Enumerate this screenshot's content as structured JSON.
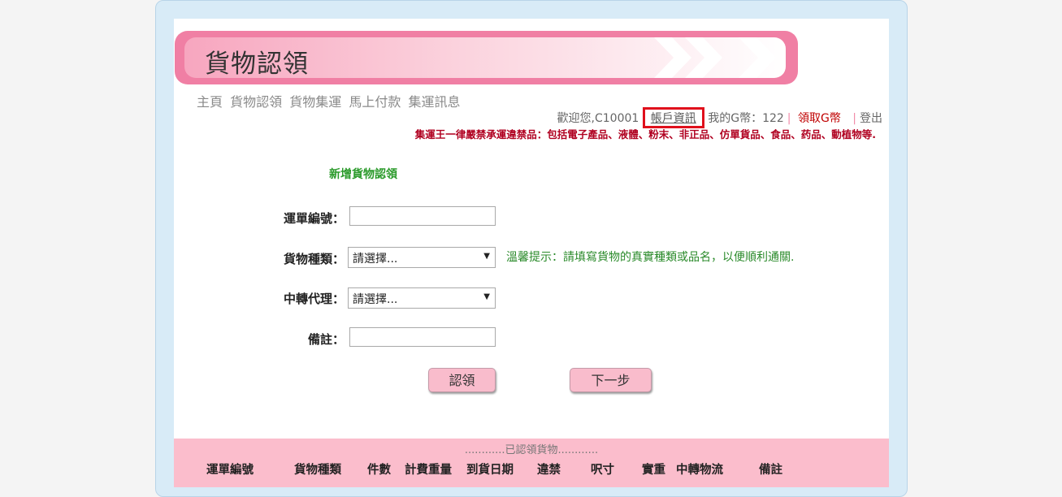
{
  "banner": {
    "title": "貨物認領"
  },
  "nav": {
    "items": [
      "主頁",
      "貨物認領",
      "貨物集運",
      "馬上付款",
      "集運訊息"
    ]
  },
  "userbar": {
    "welcome": "歡迎您,C10001",
    "account_link": "帳戶資訊",
    "gcoin_label": "我的G幣：122",
    "claim_gcoin": "領取G幣",
    "logout": "登出"
  },
  "notice": "集運王一律嚴禁承運違禁品：包括電子產品、液體、粉末、非正品、仿單貨品、食品、药品、動植物等.",
  "form": {
    "title": "新增貨物認領",
    "waybill_label": "運單編號：",
    "waybill_value": "",
    "type_label": "貨物種類：",
    "type_selected": "請選擇...",
    "agent_label": "中轉代理：",
    "agent_selected": "請選擇...",
    "remark_label": "備註：",
    "remark_value": "",
    "hint": "溫馨提示：請填寫貨物的真實種類或品名，以便順利通關.",
    "claim_button": "認領",
    "next_button": "下一步"
  },
  "claimed": {
    "title": "............已認領貨物............",
    "columns": [
      "運單編號",
      "貨物種類",
      "件數",
      "計費重量",
      "到貨日期",
      "違禁",
      "呎寸",
      "實重",
      "中轉物流",
      "備註"
    ]
  },
  "colors": {
    "pink_accent": "#f07fa4",
    "green_text": "#2a9a2a",
    "red_text": "#b00020"
  }
}
